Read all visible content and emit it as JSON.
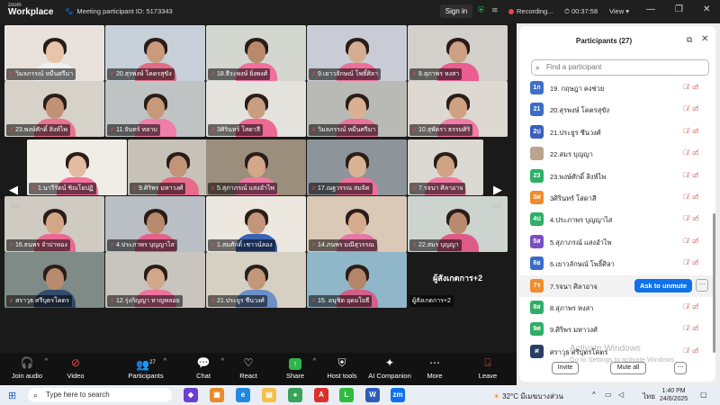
{
  "app": {
    "logo_top": "zoom",
    "logo_bottom": "Workplace",
    "meeting_id": "Meeting participant ID: 5173343",
    "sign_in": "Sign in",
    "recording": "Recording...",
    "timer": "00:37:58",
    "view": "View"
  },
  "video": {
    "tiles": [
      {
        "name": "วิมลภรรณ์ หมื่นศรีมา",
        "bg": "#e9e2dc",
        "shirt": "#f0f0f0",
        "skin": "#e8c4aa"
      },
      {
        "name": "20.สุรพงษ์ โคตรสุขัง",
        "bg": "#c7d0d8",
        "shirt": "#e26b87",
        "skin": "#c99b7c"
      },
      {
        "name": "18.ธีระพงษ์ ยิ่งพงศ์",
        "bg": "#d4d6d0",
        "shirt": "#f26fa0",
        "skin": "#b8896b"
      },
      {
        "name": "9.เยาวลักษณ์ โพธิ์ศิลา",
        "bg": "#c9ccd4",
        "shirt": "#ee6e9c",
        "skin": "#d5ad90"
      },
      {
        "name": "8.สุภาพร หงสา",
        "bg": "#d3d0cb",
        "shirt": "#ec5e92",
        "skin": "#cda184"
      },
      {
        "name": "23.พงษ์ศักดิ์ สิงห์ไพ",
        "bg": "#d6d2c9",
        "shirt": "#ea7391",
        "skin": "#c19276"
      },
      {
        "name": "11.จันทร์ หลาบ",
        "bg": "#bfc3c4",
        "shirt": "#f07ea8",
        "skin": "#c7987a"
      },
      {
        "name": "3ศิรินทร์ โสดาสี",
        "bg": "#e4e2dc",
        "shirt": "#ed6993",
        "skin": "#c89d80"
      },
      {
        "name": "วิมลภรรณ์ หมื่นศรีมา",
        "bg": "#b9b9b5",
        "shirt": "#e9739b",
        "skin": "#d9b192"
      },
      {
        "name": "10.สุพัตรา ธรรมศิริ",
        "bg": "#ddd8d1",
        "shirt": "#f27aa6",
        "skin": "#cfa283"
      },
      {
        "name": "1.นารีรัตน์ ชิณโยปฏิ",
        "bg": "#f0ece6",
        "shirt": "#f4729d",
        "skin": "#e1bca0"
      },
      {
        "name": "9.ศิริพร มหาวงศ์",
        "bg": "#c6c2b8",
        "shirt": "#e96b8c",
        "skin": "#c29478"
      },
      {
        "name": "5.สุภาภรณ์ แสงอำไพ",
        "bg": "#9c8e7d",
        "shirt": "#ee79a3",
        "skin": "#d3a787"
      },
      {
        "name": "17.ณฐวรรณ สมจิต",
        "bg": "#8d949a",
        "shirt": "#ee6f9a",
        "skin": "#d9b394"
      },
      {
        "name": "7.รจนา ศิลาอาจ",
        "bg": "#dcd8d2",
        "shirt": "#f07ba5",
        "skin": "#d0a386"
      },
      {
        "name": "16.ธนพร จำปาทอง",
        "bg": "#cfcac2",
        "shirt": "#ea6992",
        "skin": "#d2a788"
      },
      {
        "name": "4.ประภาพร บุญญาไส",
        "bg": "#b9bfc4",
        "shirt": "#e5628d",
        "skin": "#b88a6c"
      },
      {
        "name": "1.สมศักดิ์ เชาวน์ลอง",
        "bg": "#ece7df",
        "shirt": "#3b63b4",
        "skin": "#c3957a"
      },
      {
        "name": "14.ภนพร มณีสุวรรณ",
        "bg": "#d9c9b6",
        "shirt": "#e57aa1",
        "skin": "#d6ab8d"
      },
      {
        "name": "22.สมร บุญญา",
        "bg": "#cdd3cf",
        "shirt": "#de5b87",
        "skin": "#b98b6e"
      },
      {
        "name": "สราวุธ ศรีบุตรโคตร",
        "bg": "#7e8b86",
        "shirt": "#344b6b",
        "skin": "#b88b6f"
      },
      {
        "name": "12.รุ่งกิญญา หาญพลอย",
        "bg": "#c8c5bf",
        "shirt": "#ec72a0",
        "skin": "#d2a78a"
      },
      {
        "name": "21.ประยูร ชีนวงศ์",
        "bg": "#d6d0c3",
        "shirt": "#6d8fc7",
        "skin": "#c2977c"
      },
      {
        "name": "15. อนุชิต อุดมโยธี",
        "bg": "#8fb6c9",
        "shirt": "#d45e87",
        "skin": "#b48669"
      }
    ],
    "more_label": "ผู้สังเกตการ+2",
    "more_name": "ผู้สังเกตการ+2",
    "page_left": "2/2",
    "page_right": "2/2"
  },
  "toolbar": {
    "join_audio": "Join audio",
    "video": "Video",
    "participants": "Participants",
    "participants_count": "27",
    "chat": "Chat",
    "react": "React",
    "share": "Share",
    "host_tools": "Host tools",
    "ai_companion": "AI Companion",
    "more": "More",
    "leave": "Leave"
  },
  "panel": {
    "title": "Participants (27)",
    "search_placeholder": "Find a participant",
    "participants": [
      {
        "avatar": "1ก",
        "color": "#3f6fc9",
        "name": "19. กฤษฎา คงช่วย"
      },
      {
        "avatar": "21",
        "color": "#3a6ec4",
        "name": "20.สุรพงษ์ โคตรสุขัง"
      },
      {
        "avatar": "2ป",
        "color": "#3b5fbf",
        "name": "21.ประยูร ชีนวงศ์"
      },
      {
        "avatar": "",
        "color": "#b9a48f",
        "name": "22.สมร บุญญา"
      },
      {
        "avatar": "23",
        "color": "#2fae66",
        "name": "23.พงษ์ศักดิ์ สิงห์ไพ"
      },
      {
        "avatar": "3ศ",
        "color": "#f08c2c",
        "name": "3ศิรินทร์ โสดาสี"
      },
      {
        "avatar": "4ป",
        "color": "#2fae66",
        "name": "4.ประภาพร บุญญาไส"
      },
      {
        "avatar": "5ส",
        "color": "#7a4fc4",
        "name": "5.สุภาภรณ์ แสงอำไพ"
      },
      {
        "avatar": "6ย",
        "color": "#3a6ec4",
        "name": "6.เยาวลักษณ์ โพธิ์ศิลา"
      },
      {
        "avatar": "7ร",
        "color": "#f08c2c",
        "name": "7.รจนา ศิลาอาจ"
      },
      {
        "avatar": "8ส",
        "color": "#2fae66",
        "name": "8.สุภาพร หงสา"
      },
      {
        "avatar": "9ศ",
        "color": "#2fae66",
        "name": "9.ศิริพร มหาวงศ์"
      },
      {
        "avatar": "ศ",
        "color": "#2a3d66",
        "name": "ศราวุธ ศรีบุตรโคตร"
      }
    ],
    "ask_unmute": "Ask to unmute",
    "invite": "Invite",
    "mute_all": "Mute all",
    "activate_title": "Activate Windows",
    "activate_sub": "Go to Settings to activate Windows."
  },
  "taskbar": {
    "search_placeholder": "Type here to search",
    "weather": "32°C มีเมฆบางส่วน",
    "lang": "ไทย",
    "time": "1:40 PM",
    "date": "24/6/2025"
  }
}
